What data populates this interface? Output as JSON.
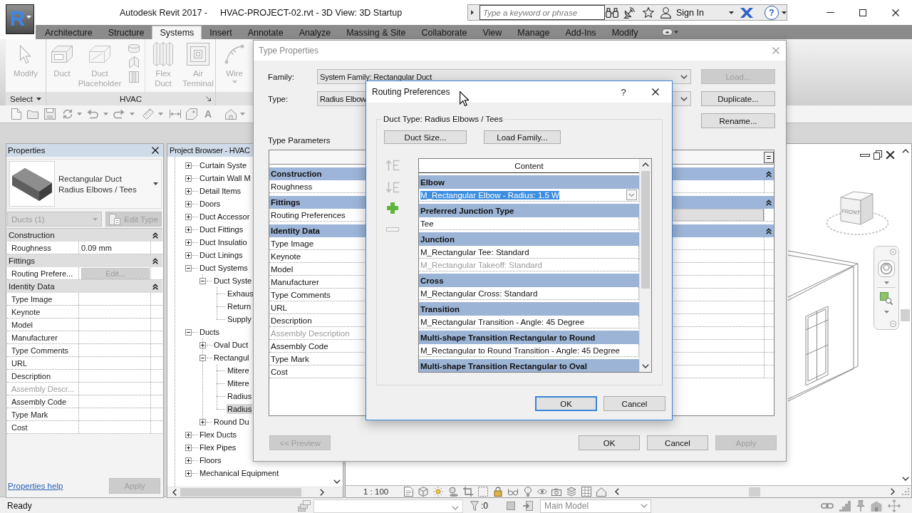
{
  "app_button": {
    "label": "R"
  },
  "title_bar": {
    "app_name": "Autodesk Revit 2017 -",
    "document": "HVAC-PROJECT-02.rvt - 3D View: 3D Startup",
    "search": {
      "placeholder": "Type a keyword or phrase"
    },
    "sign_in": "Sign In",
    "help": "?"
  },
  "ribbon": {
    "tabs": [
      {
        "label": "Architecture",
        "selected": false
      },
      {
        "label": "Structure",
        "selected": false
      },
      {
        "label": "Systems",
        "selected": true
      },
      {
        "label": "Insert",
        "selected": false
      },
      {
        "label": "Annotate",
        "selected": false
      },
      {
        "label": "Analyze",
        "selected": false
      },
      {
        "label": "Massing & Site",
        "selected": false
      },
      {
        "label": "Collaborate",
        "selected": false
      },
      {
        "label": "View",
        "selected": false
      },
      {
        "label": "Manage",
        "selected": false
      },
      {
        "label": "Add-Ins",
        "selected": false
      },
      {
        "label": "Modify",
        "selected": false
      }
    ],
    "panels": [
      {
        "label": "Select",
        "dropdown": true,
        "launcher": false,
        "tools": [
          {
            "kind": "large",
            "label": "Modify",
            "disabled": true
          }
        ]
      },
      {
        "label": "HVAC",
        "dropdown": false,
        "launcher": true,
        "tools": [
          {
            "kind": "large",
            "label": "Duct",
            "disabled": true
          },
          {
            "kind": "large",
            "label": "Duct Placeholder",
            "disabled": true
          },
          {
            "kind": "stack",
            "disabled": true
          },
          {
            "kind": "large",
            "label": "Flex Duct",
            "disabled": true
          },
          {
            "kind": "large",
            "label": "Air Terminal",
            "disabled": true
          }
        ]
      },
      {
        "tools": [
          {
            "kind": "split",
            "label": "Wire",
            "disabled": true
          }
        ]
      }
    ]
  },
  "quick_access": {
    "text_tool": "A"
  },
  "properties": {
    "title": "Properties",
    "type_selector": {
      "family": "Rectangular Duct",
      "type": "Radius Elbows / Tees"
    },
    "filter": {
      "value": "Ducts (1)",
      "disabled": true
    },
    "edit_type": {
      "label": "Edit Type",
      "disabled": true
    },
    "groups": [
      {
        "title": "Construction",
        "expanded": true,
        "rows": [
          {
            "name": "Roughness",
            "kind": "text",
            "value": "0.09 mm",
            "disabled": false
          }
        ]
      },
      {
        "title": "Fittings",
        "expanded": true,
        "rows": [
          {
            "name": "Routing Prefere...",
            "kind": "button",
            "value": "Edit...",
            "disabled": false
          }
        ]
      },
      {
        "title": "Identity Data",
        "expanded": true,
        "rows": [
          {
            "name": "Type Image",
            "kind": "text",
            "disabled": false
          },
          {
            "name": "Keynote",
            "kind": "text",
            "disabled": false
          },
          {
            "name": "Model",
            "kind": "text",
            "disabled": false
          },
          {
            "name": "Manufacturer",
            "kind": "text",
            "disabled": false
          },
          {
            "name": "Type Comments",
            "kind": "text",
            "disabled": false
          },
          {
            "name": "URL",
            "kind": "text",
            "disabled": false
          },
          {
            "name": "Description",
            "kind": "text",
            "disabled": false
          },
          {
            "name": "Assembly Descr...",
            "kind": "text",
            "disabled": true
          },
          {
            "name": "Assembly Code",
            "kind": "text",
            "disabled": false
          },
          {
            "name": "Type Mark",
            "kind": "text",
            "disabled": false
          },
          {
            "name": "Cost",
            "kind": "text",
            "disabled": false
          }
        ]
      }
    ],
    "help_link": "Properties help",
    "apply": {
      "label": "Apply",
      "disabled": true
    }
  },
  "project_browser": {
    "title": "Project Browser - HVAC",
    "items": [
      {
        "label": "Curtain Syste",
        "expanded": false,
        "selected": false
      },
      {
        "label": "Curtain Wall M",
        "expanded": false,
        "selected": false
      },
      {
        "label": "Detail Items",
        "expanded": false,
        "selected": false
      },
      {
        "label": "Doors",
        "expanded": false,
        "selected": false
      },
      {
        "label": "Duct Accessor",
        "expanded": false,
        "selected": false
      },
      {
        "label": "Duct Fittings",
        "expanded": false,
        "selected": false
      },
      {
        "label": "Duct Insulatio",
        "expanded": false,
        "selected": false
      },
      {
        "label": "Duct Linings",
        "expanded": false,
        "selected": false
      },
      {
        "label": "Duct Systems",
        "expanded": true,
        "selected": false,
        "children": [
          {
            "label": "Duct Syste",
            "expanded": true,
            "selected": false,
            "children": [
              {
                "label": "Exhaus",
                "selected": false
              },
              {
                "label": "Return",
                "selected": false
              },
              {
                "label": "Supply",
                "selected": false
              }
            ]
          }
        ]
      },
      {
        "label": "Ducts",
        "expanded": true,
        "selected": false,
        "children": [
          {
            "label": "Oval Duct",
            "expanded": false,
            "selected": false
          },
          {
            "label": "Rectangul",
            "expanded": true,
            "selected": false,
            "children": [
              {
                "label": "Mitere",
                "selected": false
              },
              {
                "label": "Mitere",
                "selected": false
              },
              {
                "label": "Radius",
                "selected": false
              },
              {
                "label": "Radius",
                "selected": true
              }
            ]
          },
          {
            "label": "Round Du",
            "expanded": false,
            "selected": false
          }
        ]
      },
      {
        "label": "Flex Ducts",
        "expanded": false,
        "selected": false
      },
      {
        "label": "Flex Pipes",
        "expanded": false,
        "selected": false
      },
      {
        "label": "Floors",
        "expanded": false,
        "selected": false
      },
      {
        "label": "Mechanical Equipment",
        "expanded": false,
        "selected": false
      }
    ]
  },
  "view": {
    "scale": "1 : 100",
    "view_cube_label": "FRONT"
  },
  "status_bar": {
    "message": "Ready",
    "filter_count": ":0",
    "design_option": "Main Model"
  },
  "type_properties": {
    "title": "Type Properties",
    "fields": [
      {
        "label": "Family:",
        "value": "System Family: Rectangular Duct"
      },
      {
        "label": "Type:",
        "value": "Radius Elbow"
      }
    ],
    "side_buttons": [
      {
        "label": "Load...",
        "disabled": true
      },
      {
        "label": "Duplicate...",
        "disabled": false
      },
      {
        "label": "Rename...",
        "disabled": false
      }
    ],
    "parameters_label": "Type Parameters",
    "header_button": "=",
    "groups": [
      {
        "title": "Construction",
        "expanded": true,
        "rows": [
          {
            "name": "Roughness",
            "kind": "text",
            "disabled": false
          }
        ]
      },
      {
        "title": "Fittings",
        "expanded": true,
        "rows": [
          {
            "name": "Routing Preferences",
            "kind": "button",
            "disabled": false
          }
        ]
      },
      {
        "title": "Identity Data",
        "expanded": true,
        "rows": [
          {
            "name": "Type Image",
            "kind": "text",
            "disabled": false
          },
          {
            "name": "Keynote",
            "kind": "text",
            "disabled": false
          },
          {
            "name": "Model",
            "kind": "text",
            "disabled": false
          },
          {
            "name": "Manufacturer",
            "kind": "text",
            "disabled": false
          },
          {
            "name": "Type Comments",
            "kind": "text",
            "disabled": false
          },
          {
            "name": "URL",
            "kind": "text",
            "disabled": false
          },
          {
            "name": "Description",
            "kind": "text",
            "disabled": false
          },
          {
            "name": "Assembly Description",
            "kind": "text",
            "disabled": true
          },
          {
            "name": "Assembly Code",
            "kind": "text",
            "disabled": false
          },
          {
            "name": "Type Mark",
            "kind": "text",
            "disabled": false
          },
          {
            "name": "Cost",
            "kind": "text",
            "disabled": false
          }
        ]
      }
    ],
    "preview": {
      "label": "<< Preview",
      "disabled": true
    },
    "buttons": [
      {
        "label": "OK",
        "disabled": false
      },
      {
        "label": "Cancel",
        "disabled": false
      },
      {
        "label": "Apply",
        "disabled": true
      }
    ]
  },
  "routing_preferences": {
    "title": "Routing Preferences",
    "help": "?",
    "duct_type": "Duct Type: Radius Elbows / Tees",
    "top_buttons": [
      "Duct Size...",
      "Load Family..."
    ],
    "side_tools": [
      {
        "disabled": true
      },
      {
        "disabled": true
      },
      {
        "disabled": false
      },
      {
        "disabled": true
      }
    ],
    "column": "Content",
    "groups": [
      {
        "title": "Elbow",
        "items": [
          {
            "text": "M_Rectangular Elbow - Radius: 1.5 W",
            "selected": true,
            "disabled": false
          }
        ]
      },
      {
        "title": "Preferred Junction Type",
        "items": [
          {
            "text": "Tee",
            "selected": false,
            "disabled": false
          }
        ]
      },
      {
        "title": "Junction",
        "items": [
          {
            "text": "M_Rectangular Tee: Standard",
            "selected": false,
            "disabled": false
          },
          {
            "text": "M_Rectangular Takeoff: Standard",
            "selected": false,
            "disabled": true
          }
        ]
      },
      {
        "title": "Cross",
        "items": [
          {
            "text": "M_Rectangular Cross: Standard",
            "selected": false,
            "disabled": false
          }
        ]
      },
      {
        "title": "Transition",
        "items": [
          {
            "text": "M_Rectangular Transition - Angle: 45 Degree",
            "selected": false,
            "disabled": false
          }
        ]
      },
      {
        "title": "Multi-shape Transition Rectangular to Round",
        "items": [
          {
            "text": "M_Rectangular to Round Transition - Angle: 45 Degree",
            "selected": false,
            "disabled": false
          }
        ]
      },
      {
        "title": "Multi-shape Transition Rectangular to Oval"
      }
    ],
    "buttons": [
      {
        "label": "OK",
        "default": true
      },
      {
        "label": "Cancel",
        "default": false
      }
    ]
  }
}
